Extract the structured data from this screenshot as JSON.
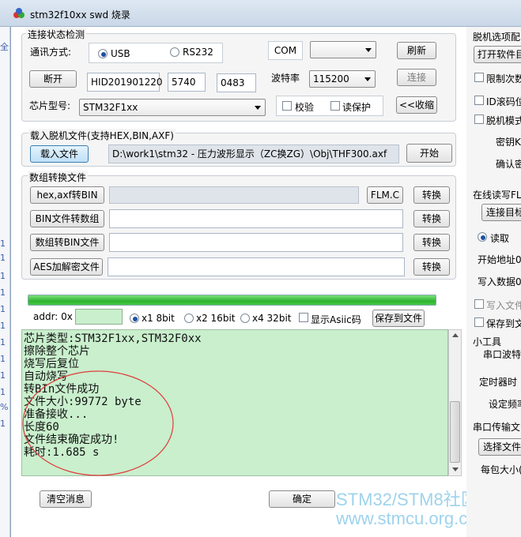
{
  "window": {
    "title": "stm32f10xx swd 烧录"
  },
  "left_strip": {
    "texts": [
      "全",
      "%",
      "1",
      "1",
      "1",
      "1",
      "1",
      "1",
      "1",
      "1",
      "1",
      "1",
      "1"
    ]
  },
  "connection": {
    "group_title": "连接状态检测",
    "comm_label": "通讯方式:",
    "usb_label": "USB",
    "rs232_label": "RS232",
    "com_label": "COM",
    "com_value": "",
    "refresh_button": "刷新",
    "disconnect_button": "断开",
    "device_id": "HID201901220",
    "vid": "5740",
    "pid": "0483",
    "baud_label": "波特率",
    "baud_value": "115200",
    "connect_button": "连接",
    "chip_label": "芯片型号:",
    "chip_value": "STM32F1xx",
    "verify_label": "校验",
    "read_protect_label": "读保护",
    "collapse_button": "<<收缩"
  },
  "load_file": {
    "group_title": "载入脱机文件(支持HEX,BIN,AXF)",
    "load_button": "载入文件",
    "path": "D:\\work1\\stm32 - 压力波形显示（ZC换ZG）\\Obj\\THF300.axf",
    "start_button": "开始"
  },
  "convert": {
    "group_title": "数组转换文件",
    "rows": [
      {
        "button": "hex,axf转BIN",
        "convert": "转换"
      },
      {
        "button": "BIN文件转数组",
        "convert": "转换"
      },
      {
        "button": "数组转BIN文件",
        "convert": "转换"
      },
      {
        "button": "AES加解密文件",
        "convert": "转换"
      }
    ],
    "flm_button": "FLM.C"
  },
  "progress": {
    "value": 1.0
  },
  "display": {
    "addr_label": "addr: 0x",
    "addr_value": "",
    "x1_label": "x1 8bit",
    "x2_label": "x2 16bit",
    "x4_label": "x4 32bit",
    "ascii_label": "显示Asiic码",
    "save_button": "保存到文件"
  },
  "log": {
    "lines": [
      "芯片类型:STM32F1xx,STM32F0xx",
      "擦除整个芯片",
      "烧写后复位",
      "自动烧写",
      "转BIn文件成功",
      "文件大小:99772 byte",
      "准备接收...",
      "长度60",
      "文件结束确定成功!",
      "耗时:1.685 s"
    ]
  },
  "bottom": {
    "clear_button": "清空消息",
    "ok_button": "确定"
  },
  "watermark": {
    "line1": "STM32/STM8社区",
    "line2": "www.stmcu.org.cn"
  },
  "right_panel": {
    "offline_title": "脱机选项配",
    "open_button": "打开软件目",
    "limit_label": "限制次数",
    "id_label": "ID滚码位",
    "offline_mode_label": "脱机模式",
    "key_label": "密钥K",
    "confirm_key_label": "确认密",
    "online_title": "在线读写FL",
    "connect_target_button": "连接目标",
    "read_label": "读取",
    "start_addr_label": "开始地址0",
    "write_data_label": "写入数据0",
    "write_file_label": "写入文件",
    "save_file_label": "保存到文",
    "tools_title": "小工具",
    "serial_wave_label": "串口波特",
    "timer_label": "定时器时",
    "set_freq_label": "设定频率",
    "serial_transfer_title": "串口传输文",
    "select_file_button": "选择文件",
    "packet_size_label": "每包大小("
  },
  "colors": {
    "log_bg": "#c9efcd",
    "progress": "#2fb32f",
    "accent": "#3c7fb1"
  }
}
